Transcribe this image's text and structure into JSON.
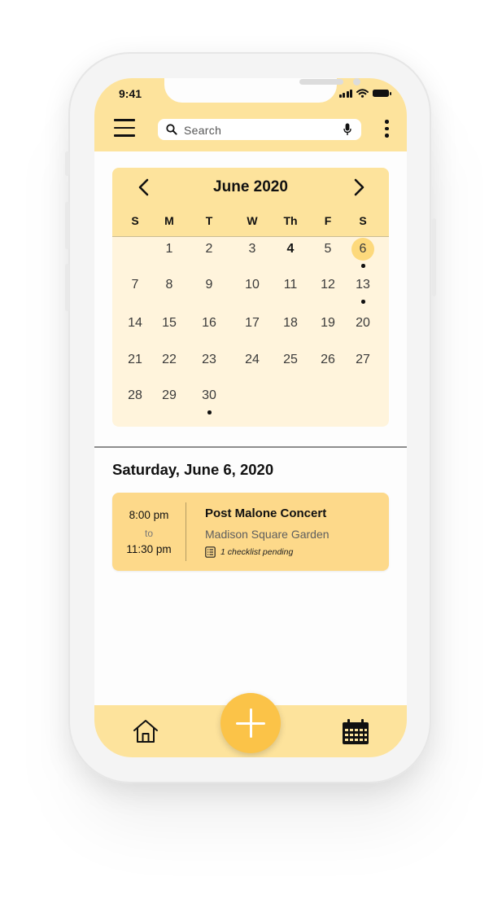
{
  "status_bar": {
    "time": "9:41"
  },
  "app_bar": {
    "menu_icon": "hamburger-menu-icon",
    "search": {
      "placeholder": "Search",
      "value": ""
    },
    "search_icon": "magnifier-icon",
    "mic_icon": "microphone-icon",
    "more_icon": "vertical-ellipsis-icon"
  },
  "calendar": {
    "month_label": "June 2020",
    "prev_icon": "chevron-left-icon",
    "next_icon": "chevron-right-icon",
    "weekdays": [
      "S",
      "M",
      "T",
      "W",
      "Th",
      "F",
      "S"
    ],
    "weeks": [
      [
        "",
        "1",
        "2",
        "3",
        "4",
        "5",
        "6"
      ],
      [
        "7",
        "8",
        "9",
        "10",
        "11",
        "12",
        "13"
      ],
      [
        "14",
        "15",
        "16",
        "17",
        "18",
        "19",
        "20"
      ],
      [
        "21",
        "22",
        "23",
        "24",
        "25",
        "26",
        "27"
      ],
      [
        "28",
        "29",
        "30",
        "",
        "",
        "",
        ""
      ]
    ],
    "today": "4",
    "selected": "6",
    "days_with_events": [
      "6",
      "13",
      "30"
    ]
  },
  "selected_date_label": "Saturday, June 6, 2020",
  "events": [
    {
      "start": "8:00 pm",
      "to_label": "to",
      "end": "11:30 pm",
      "title": "Post Malone Concert",
      "location": "Madison Square Garden",
      "checklist": "1 checklist pending",
      "checklist_icon": "checklist-icon"
    }
  ],
  "bottom_nav": {
    "home_icon": "home-icon",
    "add_icon": "plus-icon",
    "calendar_icon": "calendar-icon"
  },
  "colors": {
    "bar_yellow": "#fde39c",
    "calendar_bg": "#fff4dc",
    "event_bg": "#fdd98a",
    "fab": "#fbc348",
    "selected_day": "#fdd97c"
  }
}
